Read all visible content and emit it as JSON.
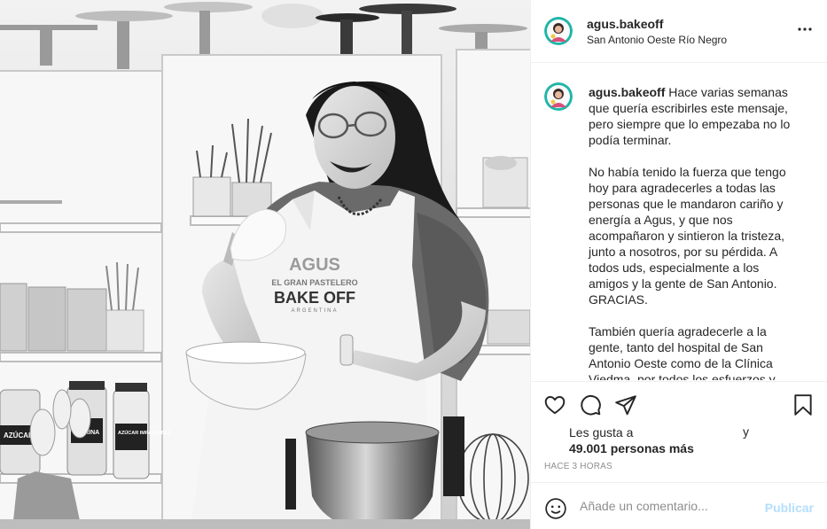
{
  "post": {
    "photo": {
      "apron_lines": [
        "AGUS",
        "EL GRAN PASTELERO",
        "BAKE OFF",
        "ARGENTINA"
      ],
      "jar_labels": [
        "AZÚCAR",
        "AZÚCAR IMPALPABLE",
        "HARINA"
      ]
    },
    "header": {
      "username": "agus.bakeoff",
      "location": "San Antonio Oeste Río Negro",
      "more_icon": "more-horizontal-icon"
    },
    "caption": {
      "username": "agus.bakeoff",
      "paragraphs": [
        "Hace varias semanas que quería escribirles este mensaje, pero siempre que lo empezaba no lo podía terminar.",
        "No había tenido la fuerza que tengo hoy para agradecerles a todas las personas que le mandaron cariño y energía a Agus, y que nos acompañaron y sintieron la tristeza, junto a nosotros, por su pérdida. A todos uds, especialmente a los amigos y la gente de San Antonio. GRACIAS.",
        "También quería agradecerle a la gente, tanto del hospital de San Antonio Oeste como de la Clínica Viedma, por todos los esfuerzos y todo lo que la cuidaron."
      ]
    },
    "actions": {
      "like_icon": "heart-icon",
      "comment_icon": "comment-icon",
      "share_icon": "paper-plane-icon",
      "save_icon": "bookmark-icon"
    },
    "likes": {
      "prefix": "Les gusta a",
      "suffix": "y",
      "count": "49.001 personas más"
    },
    "timestamp": "HACE 3 HORAS",
    "comment_box": {
      "emoji_icon": "emoji-icon",
      "placeholder": "Añade un comentario...",
      "publish_label": "Publicar"
    }
  },
  "colors": {
    "text": "#262626",
    "muted": "#8e8e8e",
    "border": "#efefef",
    "publish_disabled": "#b2dffc",
    "avatar_teal": "#1fb5a8"
  }
}
